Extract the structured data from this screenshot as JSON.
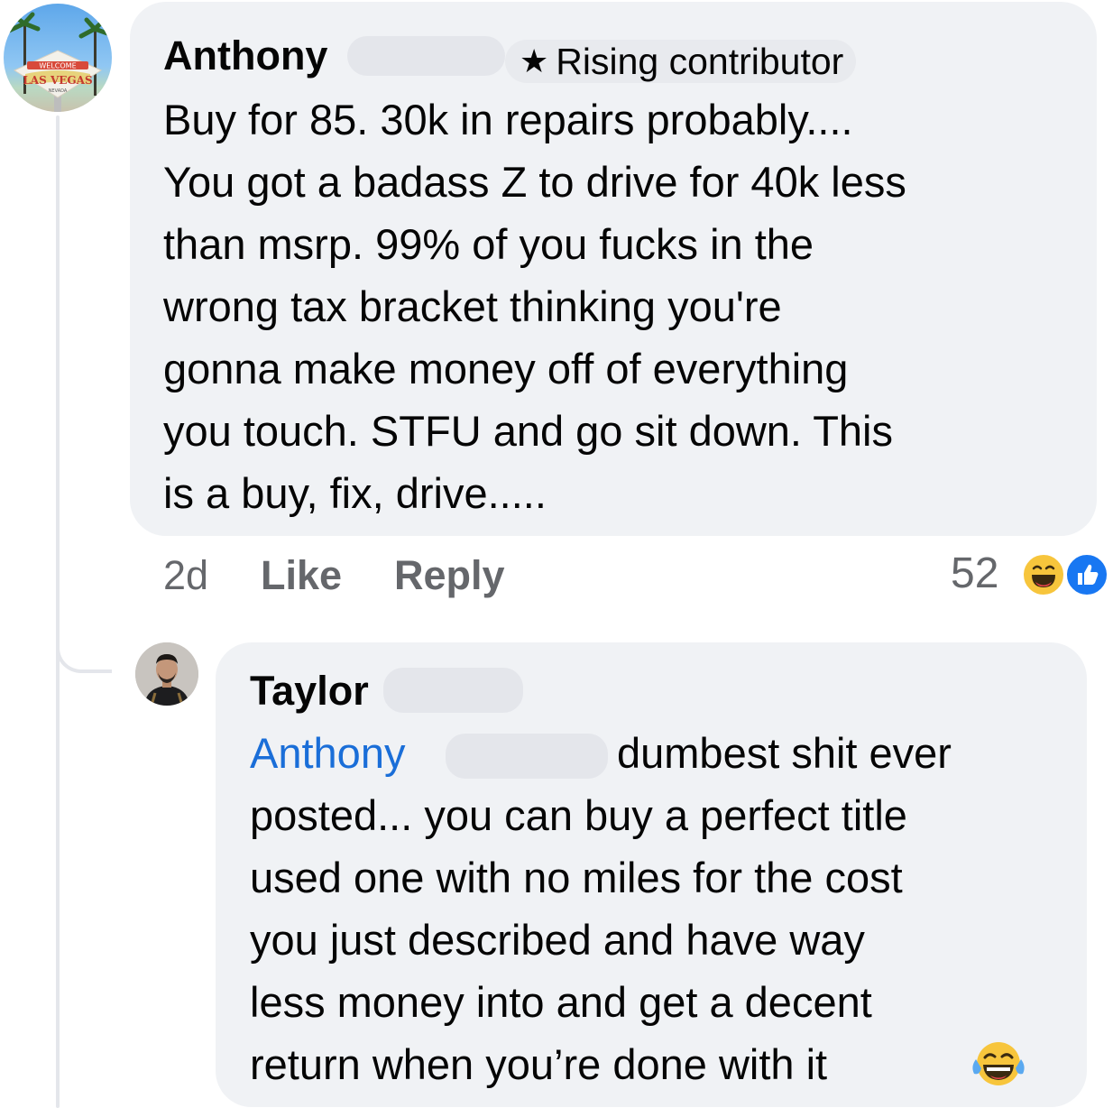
{
  "comments": [
    {
      "author": "Anthony",
      "badge": "Rising contributor",
      "badge_icon": "star-icon",
      "lines": [
        "Buy for 85. 30k in repairs probably....",
        "You got a badass Z to drive for 40k less",
        "than msrp. 99% of you fucks in the",
        "wrong tax bracket thinking you're",
        "gonna make money off of everything",
        "you touch. STFU and go sit down. This",
        "is a buy, fix, drive....."
      ],
      "time": "2d",
      "like_label": "Like",
      "reply_label": "Reply",
      "reaction_count": "52",
      "reactions": [
        "haha-icon",
        "like-icon"
      ]
    },
    {
      "author": "Taylor",
      "mention": "Anthony",
      "lines": [
        "dumbest shit ever",
        "posted... you can buy a perfect title",
        "used one with no miles for the cost",
        "you just described and have way",
        "less money into and get a decent",
        "return when you’re done with it"
      ],
      "trailing_emoji": "😂"
    }
  ],
  "colors": {
    "bubble": "#f0f2f5",
    "mention": "#1a6ed8",
    "meta": "#65676b",
    "like_blue": "#1877f2",
    "haha_yellow": "#f7c53c"
  }
}
